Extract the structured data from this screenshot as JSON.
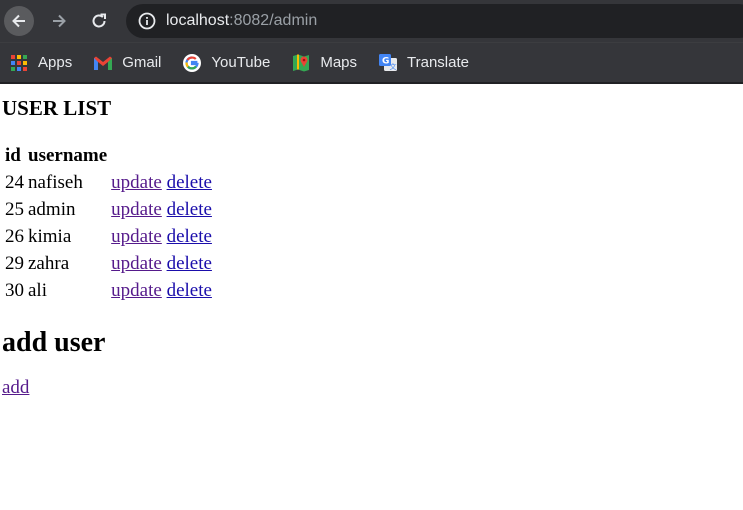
{
  "browser": {
    "url_host": "localhost",
    "url_rest": ":8082/admin",
    "bookmarks": [
      {
        "label": "Apps",
        "icon": "apps-grid-icon"
      },
      {
        "label": "Gmail",
        "icon": "gmail-icon"
      },
      {
        "label": "YouTube",
        "icon": "google-icon"
      },
      {
        "label": "Maps",
        "icon": "maps-icon"
      },
      {
        "label": "Translate",
        "icon": "translate-icon"
      }
    ]
  },
  "page": {
    "title": "USER LIST",
    "table": {
      "headers": [
        "id",
        "username"
      ],
      "rows": [
        {
          "id": "24",
          "username": "nafiseh",
          "update": "update",
          "delete": "delete"
        },
        {
          "id": "25",
          "username": "admin",
          "update": "update",
          "delete": "delete"
        },
        {
          "id": "26",
          "username": "kimia",
          "update": "update",
          "delete": "delete"
        },
        {
          "id": "29",
          "username": "zahra",
          "update": "update",
          "delete": "delete"
        },
        {
          "id": "30",
          "username": "ali",
          "update": "update",
          "delete": "delete"
        }
      ]
    },
    "add_heading": "add user",
    "add_link": "add"
  },
  "colors": {
    "link": "#1a0dab",
    "visited_link": "#551a8b",
    "chrome_bg": "#35363a",
    "omnibox_bg": "#202124"
  }
}
